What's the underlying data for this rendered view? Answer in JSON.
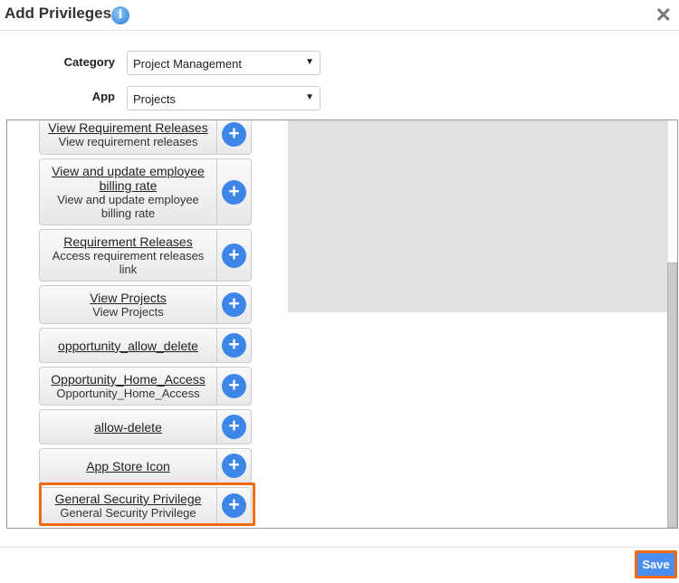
{
  "dialog": {
    "title": "Add Privileges",
    "info_icon": "info-icon",
    "close_icon": "close-icon",
    "close_glyph": "✕"
  },
  "form": {
    "category_label": "Category",
    "category_value": "Project Management",
    "app_label": "App",
    "app_value": "Projects",
    "dropdown_glyph": "▼"
  },
  "privileges": [
    {
      "title": "View Requirement Releases",
      "description": "View requirement releases"
    },
    {
      "title": "View and update employee billing rate",
      "description": "View and update employee billing rate"
    },
    {
      "title": "Requirement Releases",
      "description": "Access requirement releases link"
    },
    {
      "title": "View Projects",
      "description": "View Projects"
    },
    {
      "title": "opportunity_allow_delete",
      "description": ""
    },
    {
      "title": "Opportunity_Home_Access",
      "description": "Opportunity_Home_Access"
    },
    {
      "title": "allow-delete",
      "description": ""
    },
    {
      "title": "App Store Icon",
      "description": ""
    },
    {
      "title": "General Security Privilege",
      "description": "General Security Privilege",
      "highlighted": true
    }
  ],
  "add_glyph": "+",
  "footer": {
    "save_label": "Save"
  },
  "colors": {
    "accent": "#3d86e8",
    "highlight": "#f26a10",
    "save": "#4a8ef0"
  }
}
